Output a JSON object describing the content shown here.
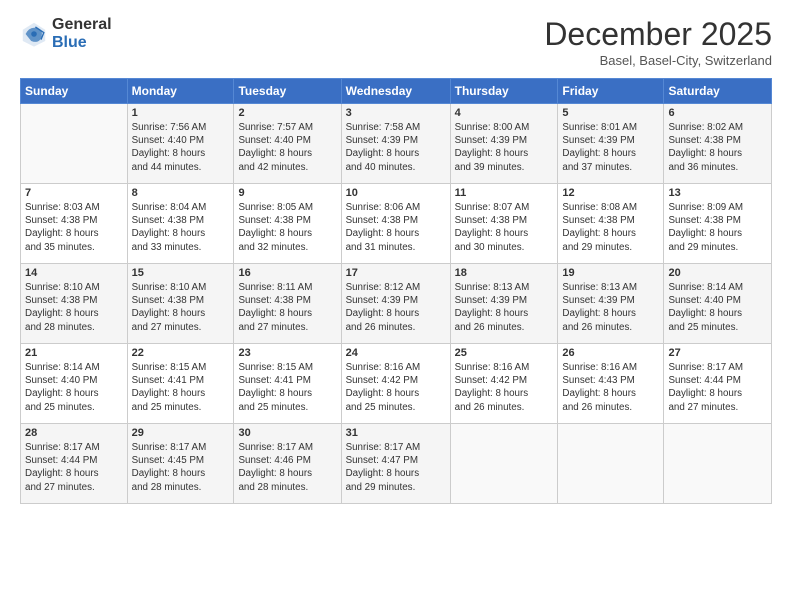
{
  "logo": {
    "general": "General",
    "blue": "Blue"
  },
  "header": {
    "month": "December 2025",
    "location": "Basel, Basel-City, Switzerland"
  },
  "weekdays": [
    "Sunday",
    "Monday",
    "Tuesday",
    "Wednesday",
    "Thursday",
    "Friday",
    "Saturday"
  ],
  "weeks": [
    [
      {
        "day": "",
        "info": ""
      },
      {
        "day": "1",
        "info": "Sunrise: 7:56 AM\nSunset: 4:40 PM\nDaylight: 8 hours\nand 44 minutes."
      },
      {
        "day": "2",
        "info": "Sunrise: 7:57 AM\nSunset: 4:40 PM\nDaylight: 8 hours\nand 42 minutes."
      },
      {
        "day": "3",
        "info": "Sunrise: 7:58 AM\nSunset: 4:39 PM\nDaylight: 8 hours\nand 40 minutes."
      },
      {
        "day": "4",
        "info": "Sunrise: 8:00 AM\nSunset: 4:39 PM\nDaylight: 8 hours\nand 39 minutes."
      },
      {
        "day": "5",
        "info": "Sunrise: 8:01 AM\nSunset: 4:39 PM\nDaylight: 8 hours\nand 37 minutes."
      },
      {
        "day": "6",
        "info": "Sunrise: 8:02 AM\nSunset: 4:38 PM\nDaylight: 8 hours\nand 36 minutes."
      }
    ],
    [
      {
        "day": "7",
        "info": "Sunrise: 8:03 AM\nSunset: 4:38 PM\nDaylight: 8 hours\nand 35 minutes."
      },
      {
        "day": "8",
        "info": "Sunrise: 8:04 AM\nSunset: 4:38 PM\nDaylight: 8 hours\nand 33 minutes."
      },
      {
        "day": "9",
        "info": "Sunrise: 8:05 AM\nSunset: 4:38 PM\nDaylight: 8 hours\nand 32 minutes."
      },
      {
        "day": "10",
        "info": "Sunrise: 8:06 AM\nSunset: 4:38 PM\nDaylight: 8 hours\nand 31 minutes."
      },
      {
        "day": "11",
        "info": "Sunrise: 8:07 AM\nSunset: 4:38 PM\nDaylight: 8 hours\nand 30 minutes."
      },
      {
        "day": "12",
        "info": "Sunrise: 8:08 AM\nSunset: 4:38 PM\nDaylight: 8 hours\nand 29 minutes."
      },
      {
        "day": "13",
        "info": "Sunrise: 8:09 AM\nSunset: 4:38 PM\nDaylight: 8 hours\nand 29 minutes."
      }
    ],
    [
      {
        "day": "14",
        "info": "Sunrise: 8:10 AM\nSunset: 4:38 PM\nDaylight: 8 hours\nand 28 minutes."
      },
      {
        "day": "15",
        "info": "Sunrise: 8:10 AM\nSunset: 4:38 PM\nDaylight: 8 hours\nand 27 minutes."
      },
      {
        "day": "16",
        "info": "Sunrise: 8:11 AM\nSunset: 4:38 PM\nDaylight: 8 hours\nand 27 minutes."
      },
      {
        "day": "17",
        "info": "Sunrise: 8:12 AM\nSunset: 4:39 PM\nDaylight: 8 hours\nand 26 minutes."
      },
      {
        "day": "18",
        "info": "Sunrise: 8:13 AM\nSunset: 4:39 PM\nDaylight: 8 hours\nand 26 minutes."
      },
      {
        "day": "19",
        "info": "Sunrise: 8:13 AM\nSunset: 4:39 PM\nDaylight: 8 hours\nand 26 minutes."
      },
      {
        "day": "20",
        "info": "Sunrise: 8:14 AM\nSunset: 4:40 PM\nDaylight: 8 hours\nand 25 minutes."
      }
    ],
    [
      {
        "day": "21",
        "info": "Sunrise: 8:14 AM\nSunset: 4:40 PM\nDaylight: 8 hours\nand 25 minutes."
      },
      {
        "day": "22",
        "info": "Sunrise: 8:15 AM\nSunset: 4:41 PM\nDaylight: 8 hours\nand 25 minutes."
      },
      {
        "day": "23",
        "info": "Sunrise: 8:15 AM\nSunset: 4:41 PM\nDaylight: 8 hours\nand 25 minutes."
      },
      {
        "day": "24",
        "info": "Sunrise: 8:16 AM\nSunset: 4:42 PM\nDaylight: 8 hours\nand 25 minutes."
      },
      {
        "day": "25",
        "info": "Sunrise: 8:16 AM\nSunset: 4:42 PM\nDaylight: 8 hours\nand 26 minutes."
      },
      {
        "day": "26",
        "info": "Sunrise: 8:16 AM\nSunset: 4:43 PM\nDaylight: 8 hours\nand 26 minutes."
      },
      {
        "day": "27",
        "info": "Sunrise: 8:17 AM\nSunset: 4:44 PM\nDaylight: 8 hours\nand 27 minutes."
      }
    ],
    [
      {
        "day": "28",
        "info": "Sunrise: 8:17 AM\nSunset: 4:44 PM\nDaylight: 8 hours\nand 27 minutes."
      },
      {
        "day": "29",
        "info": "Sunrise: 8:17 AM\nSunset: 4:45 PM\nDaylight: 8 hours\nand 28 minutes."
      },
      {
        "day": "30",
        "info": "Sunrise: 8:17 AM\nSunset: 4:46 PM\nDaylight: 8 hours\nand 28 minutes."
      },
      {
        "day": "31",
        "info": "Sunrise: 8:17 AM\nSunset: 4:47 PM\nDaylight: 8 hours\nand 29 minutes."
      },
      {
        "day": "",
        "info": ""
      },
      {
        "day": "",
        "info": ""
      },
      {
        "day": "",
        "info": ""
      }
    ]
  ]
}
